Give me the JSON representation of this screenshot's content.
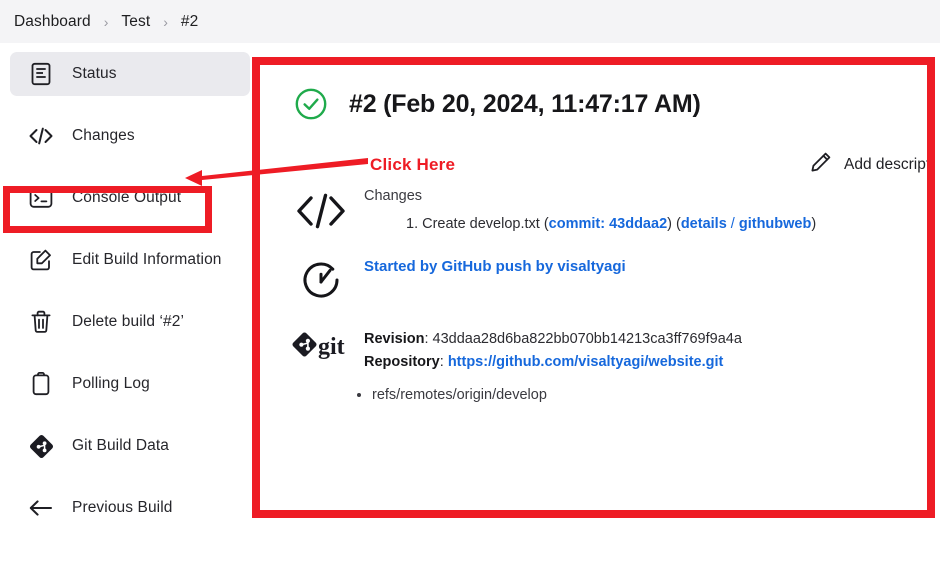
{
  "breadcrumb": {
    "items": [
      "Dashboard",
      "Test",
      "#2"
    ],
    "separator": "›"
  },
  "sidebar": {
    "items": [
      {
        "label": "Status",
        "icon": "document-icon",
        "selected": true
      },
      {
        "label": "Changes",
        "icon": "code-brackets-icon",
        "selected": false
      },
      {
        "label": "Console Output",
        "icon": "terminal-icon",
        "selected": false
      },
      {
        "label": "Edit Build Information",
        "icon": "edit-square-icon",
        "selected": false
      },
      {
        "label": "Delete build ‘#2’",
        "icon": "trash-icon",
        "selected": false
      },
      {
        "label": "Polling Log",
        "icon": "clipboard-icon",
        "selected": false
      },
      {
        "label": "Git Build Data",
        "icon": "git-icon",
        "selected": false
      },
      {
        "label": "Previous Build",
        "icon": "arrow-left-icon",
        "selected": false
      }
    ]
  },
  "main": {
    "status_icon": "success-check-icon",
    "title": "#2 (Feb 20, 2024, 11:47:17 AM)",
    "add_description": {
      "label": "Add description",
      "icon": "pencil-icon"
    },
    "changes": {
      "icon": "code-brackets-icon",
      "heading": "Changes",
      "entry_number": "1.",
      "entry_text": "Create develop.txt",
      "commit_label": "commit: 43ddaa2",
      "details_label": "details",
      "githubweb_label": "githubweb",
      "slash": "/"
    },
    "started_by": {
      "icon": "clock-icon",
      "text": "Started by GitHub push by visaltyagi"
    },
    "git": {
      "icon": "git-icon",
      "revision_label": "Revision",
      "revision_value": "43ddaa28d6ba822bb070bb14213ca3ff769f9a4a",
      "repository_label": "Repository",
      "repository_value": "https://github.com/visaltyagi/website.git",
      "refs": [
        "refs/remotes/origin/develop"
      ]
    }
  },
  "annotations": {
    "click_here_label": "Click Here",
    "accent_color": "#ee1c25",
    "highlight_target": "Console Output"
  },
  "colors": {
    "link_blue": "#1668dc",
    "success_green": "#1faa4b",
    "annotation_red": "#ee1c25",
    "breadcrumb_bg": "#f4f4f6",
    "selected_bg": "#eaeaee"
  }
}
